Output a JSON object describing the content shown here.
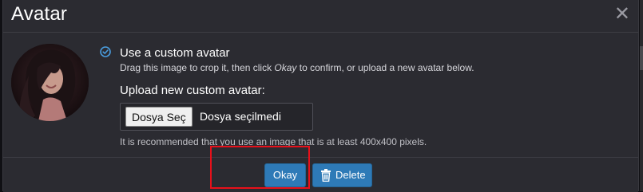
{
  "dialog": {
    "title": "Avatar",
    "close_symbol": "✕"
  },
  "avatar": {
    "icon": "user-photo"
  },
  "option": {
    "label": "Use a custom avatar",
    "desc_before": "Drag this image to crop it, then click ",
    "desc_emphasis": "Okay",
    "desc_after": " to confirm, or upload a new avatar below."
  },
  "upload": {
    "label": "Upload new custom avatar:",
    "choose_button": "Dosya Seç",
    "status": "Dosya seçilmedi",
    "help": "It is recommended that you use an image that is at least 400x400 pixels."
  },
  "footer": {
    "okay_label": "Okay",
    "delete_label": "Delete"
  },
  "colors": {
    "accent": "#2e7ab7",
    "highlight": "#e8101a",
    "dialog_bg": "#2b2b31"
  }
}
